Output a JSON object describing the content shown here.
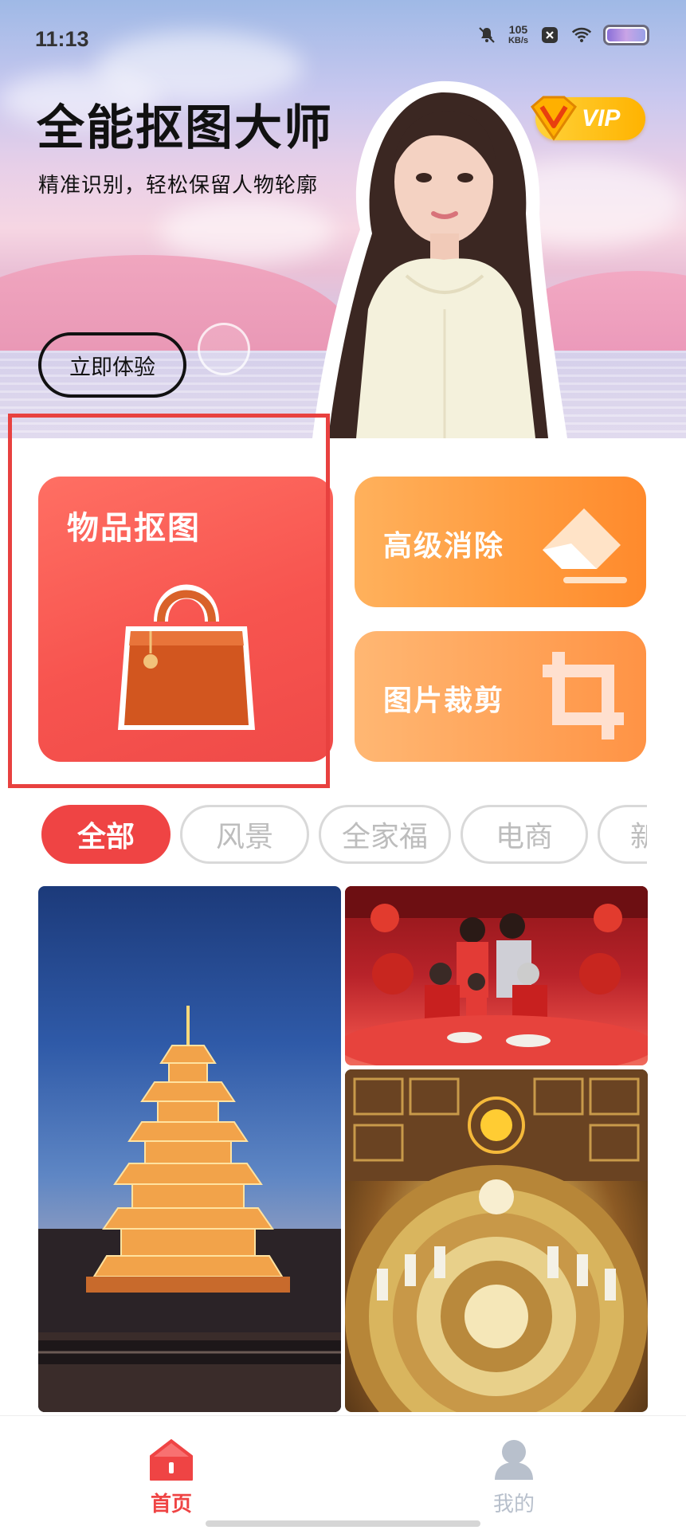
{
  "status_bar": {
    "time": "11:13",
    "net_speed_value": "105",
    "net_speed_unit": "KB/s",
    "icons": [
      "mute-icon",
      "notification-x-icon",
      "wifi-icon",
      "battery-icon"
    ]
  },
  "hero": {
    "title": "全能抠图大师",
    "subtitle": "精准识别，轻松保留人物轮廓",
    "cta_label": "立即体验",
    "vip_label": "VIP"
  },
  "features": {
    "object_cutout": {
      "label": "物品抠图",
      "icon": "handbag-icon"
    },
    "advanced_erase": {
      "label": "高级消除",
      "icon": "eraser-icon"
    },
    "image_crop": {
      "label": "图片裁剪",
      "icon": "crop-icon"
    }
  },
  "categories": {
    "items": [
      "全部",
      "风景",
      "全家福",
      "电商",
      "新"
    ],
    "selected": "全部"
  },
  "bottom_nav": {
    "items": [
      {
        "label": "首页",
        "icon": "home-icon",
        "active": true
      },
      {
        "label": "我的",
        "icon": "profile-icon",
        "active": false
      }
    ]
  },
  "colors": {
    "accent": "#ef4444",
    "erase_card": "#ff9a3d",
    "crop_card": "#ffa257",
    "inactive_chip_text": "#bdbdbd",
    "inactive_nav": "#b8c0cc",
    "vip_gold": "#ffc21a"
  }
}
